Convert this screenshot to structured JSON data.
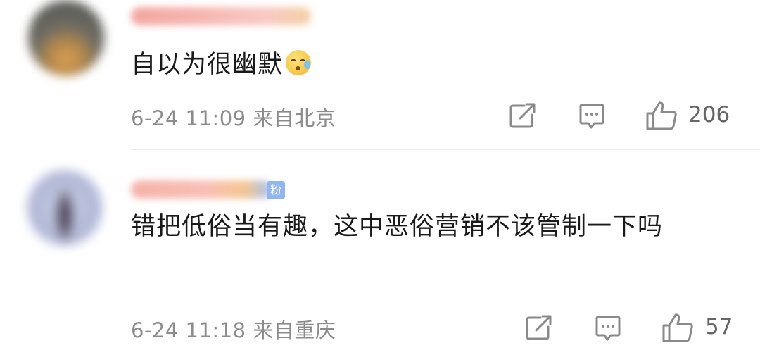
{
  "comments": [
    {
      "text": "自以为很幽默",
      "emoji": "sweat-emoji",
      "time": "6-24 11:09",
      "location": "来自北京",
      "likes": "206"
    },
    {
      "badge": "粉",
      "text": "错把低俗当有趣，这中恶俗营销不该管制一下吗",
      "time": "6-24 11:18",
      "location": "来自重庆",
      "likes": "57"
    }
  ],
  "colors": {
    "text": "#1a1a1a",
    "meta": "#8c8c8c",
    "icon": "#8a8a8a",
    "fan_badge": "#8fb6f3"
  },
  "icons": [
    "share-icon",
    "comment-icon",
    "like-icon"
  ]
}
